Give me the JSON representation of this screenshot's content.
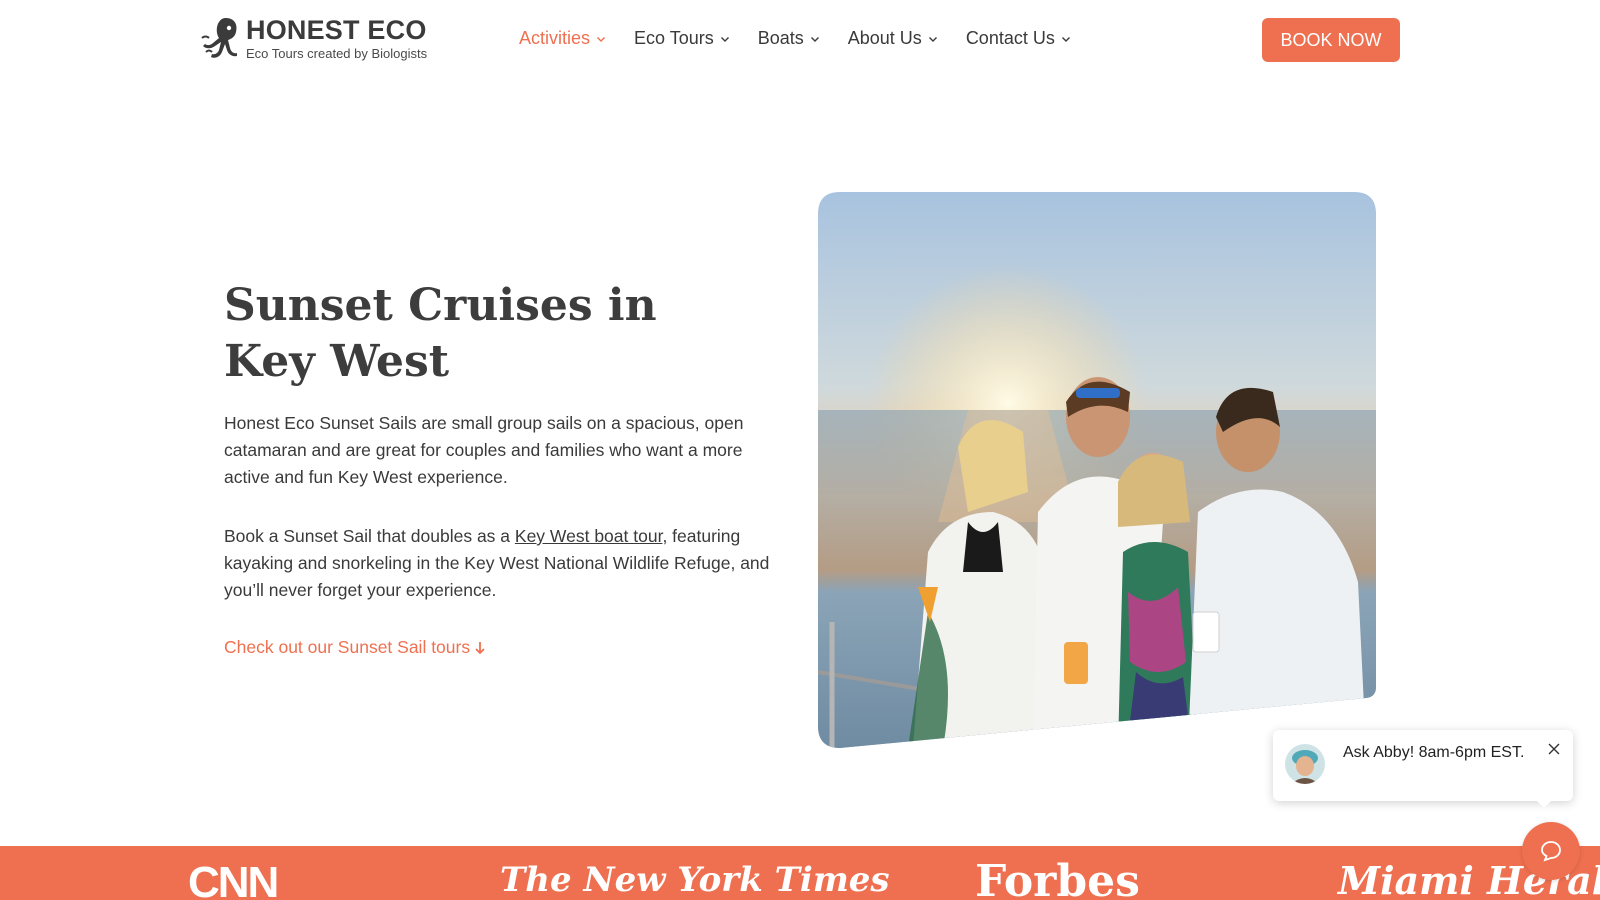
{
  "header": {
    "logo": {
      "title": "HONEST ECO",
      "tagline": "Eco Tours created by Biologists",
      "icon": "octopus-logo-icon"
    },
    "nav": [
      {
        "label": "Activities",
        "active": true
      },
      {
        "label": "Eco Tours",
        "active": false
      },
      {
        "label": "Boats",
        "active": false
      },
      {
        "label": "About Us",
        "active": false
      },
      {
        "label": "Contact Us",
        "active": false
      }
    ],
    "book_button": "BOOK NOW"
  },
  "hero": {
    "title": "Sunset Cruises in Key West",
    "paragraph1": "Honest Eco Sunset Sails are small group sails on a spacious, open catamaran and are great for couples and families who want a more active and fun Key West  experience.",
    "paragraph2_before": "Book a Sunset Sail that doubles as a ",
    "paragraph2_link": "Key West boat tour",
    "paragraph2_after": ", featuring kayaking and snorkeling in the Key West National Wildlife Refuge, and you’ll never forget your experience.",
    "cta": "Check out our Sunset Sail tours",
    "cta_icon": "arrow-down-icon",
    "photo_alt": "four-people-on-boat-at-sunset"
  },
  "chat": {
    "message": "Ask Abby! 8am-6pm EST.",
    "close_icon": "close-icon",
    "fab_icon": "chat-bubble-icon"
  },
  "press": {
    "logos": [
      "CNN",
      "The New York Times",
      "Forbes",
      "Miami Herald"
    ]
  },
  "colors": {
    "accent": "#ef7050",
    "text": "#3a3a3a",
    "background": "#ffffff"
  }
}
